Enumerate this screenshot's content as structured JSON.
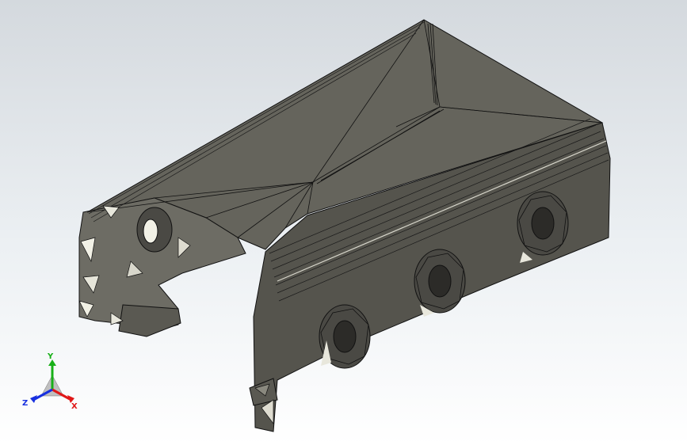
{
  "viewport": {
    "background_top": "#d4d9de",
    "background_bottom": "#ffffff",
    "model_fill": "#5f5e57",
    "model_fill_light": "#8a897f",
    "model_fill_dark": "#3e3d38",
    "edge_color": "#111111",
    "highlight_color": "#f2f1e6"
  },
  "triad": {
    "x_label": "X",
    "y_label": "Y",
    "z_label": "Z",
    "x_color": "#e01818",
    "y_color": "#18b018",
    "z_color": "#1830e0"
  }
}
